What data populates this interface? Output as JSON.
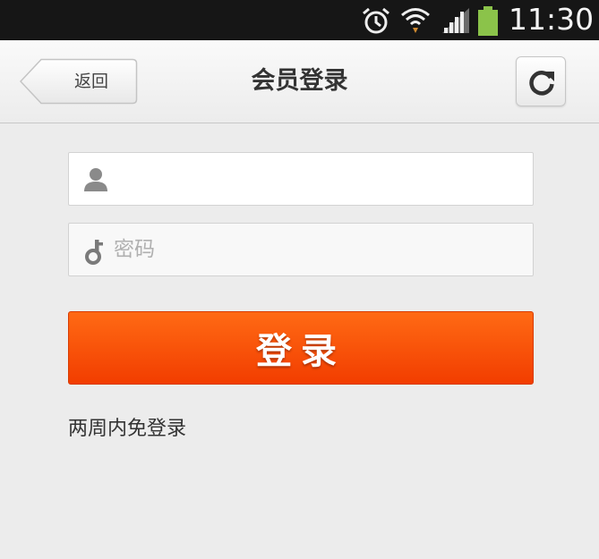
{
  "status_bar": {
    "time": "11:30",
    "icons": [
      "alarm-icon",
      "wifi-icon",
      "signal-icon",
      "battery-icon"
    ],
    "battery_color": "#8bc34a"
  },
  "nav": {
    "back_label": "返回",
    "title": "会员登录",
    "refresh_icon": "refresh-icon"
  },
  "form": {
    "username": {
      "value": "",
      "placeholder": "",
      "icon": "user-icon"
    },
    "password": {
      "value": "",
      "placeholder": "密码",
      "icon": "key-icon"
    },
    "login_label": "登录",
    "remember_label": "两周内免登录"
  },
  "colors": {
    "accent": "#ff5a0a",
    "background": "#ececec",
    "status_bar": "#161616"
  }
}
